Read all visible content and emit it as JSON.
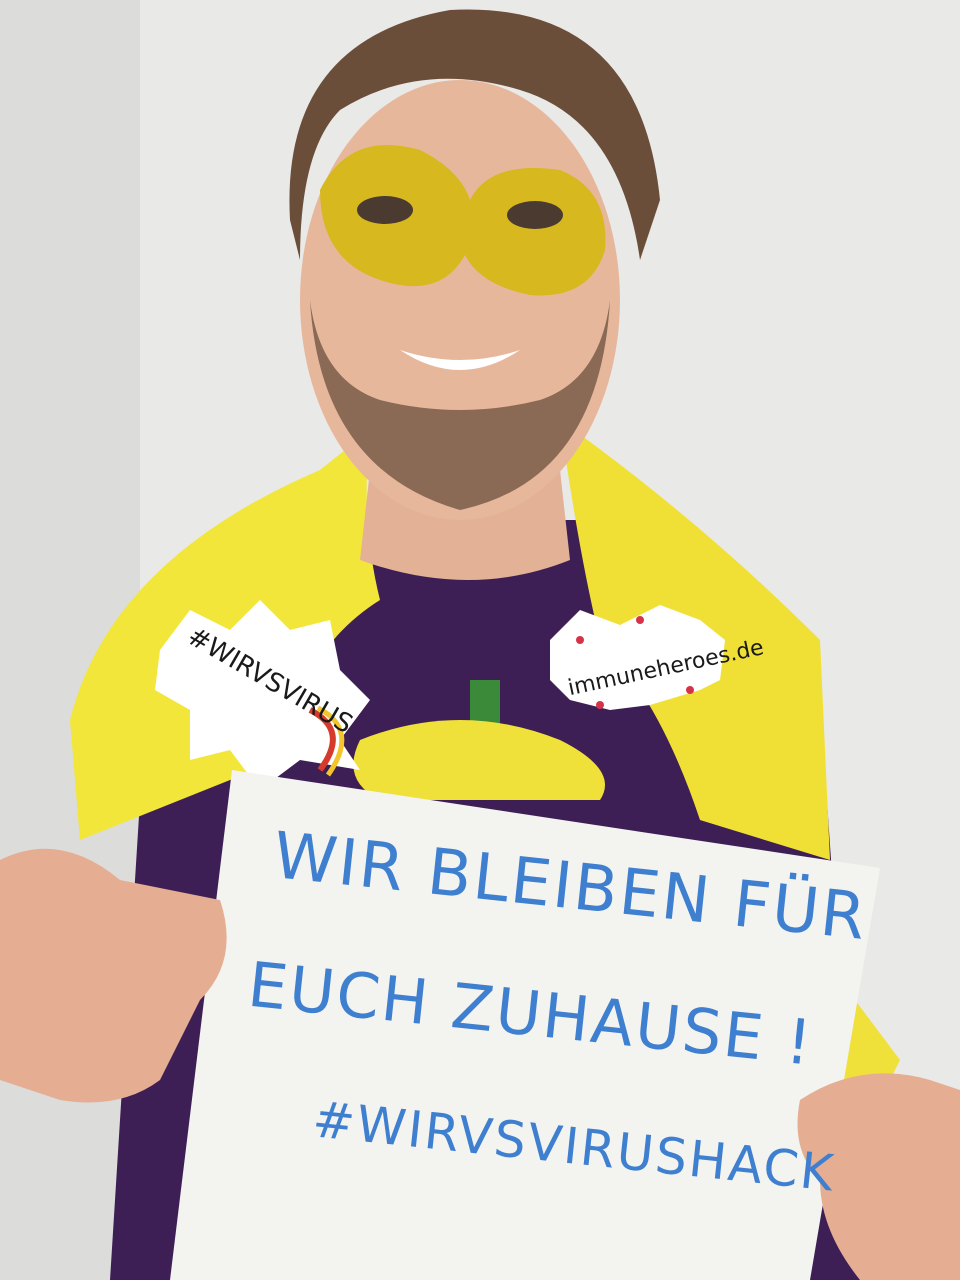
{
  "photo": {
    "subject": "person-in-yellow-mask-and-cape-holding-sign",
    "colors": {
      "wall": "#e9e9e7",
      "cape": "#f2e63a",
      "shirt": "#3d1f55",
      "mask": "#d7b81f",
      "skin": "#e7b79c",
      "hair": "#6b4e3a",
      "ink": "#3f7fd0"
    }
  },
  "sign": {
    "line1": "WIR BLEIBEN FÜR",
    "line2": "EUCH ZUHAUSE !",
    "line3": "#WIRVSVIRUSHACK"
  },
  "stickers": {
    "left": "#WIRVSVIRUS",
    "right": "immuneheroes.de"
  }
}
